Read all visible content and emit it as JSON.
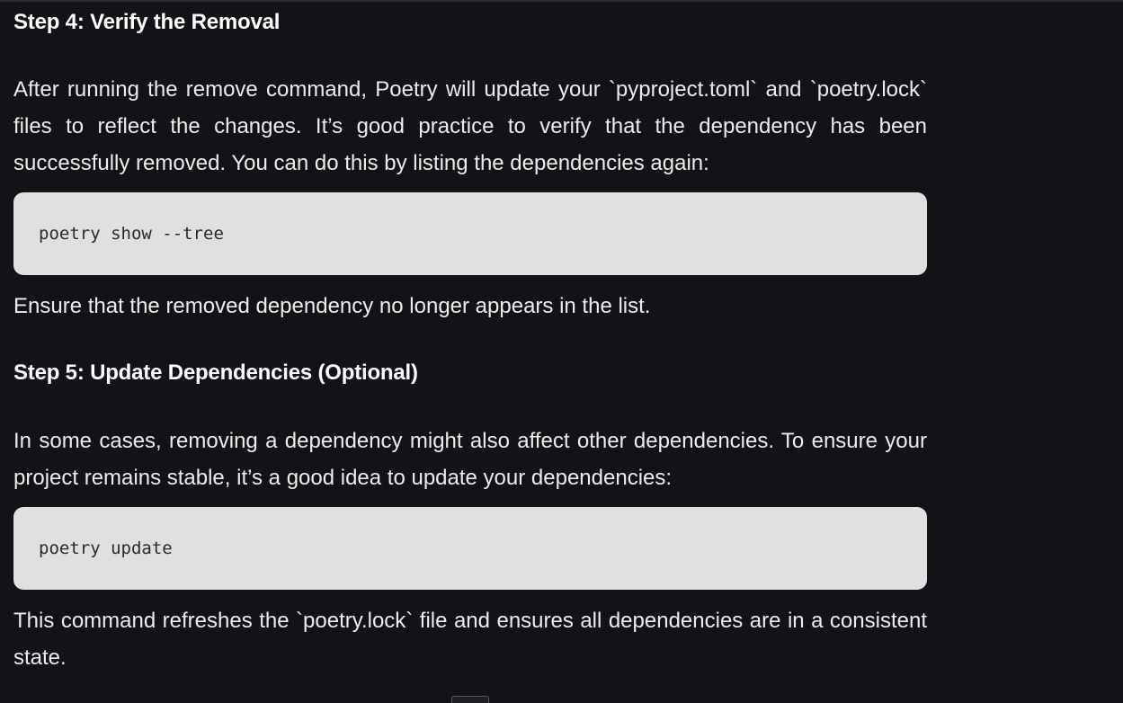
{
  "sections": [
    {
      "heading": "Step 4: Verify the Removal",
      "intro": "After running the remove command, Poetry will update your `pyproject.toml` and `poetry.lock` files to reflect the changes. It’s good practice to verify that the dependency has been successfully removed. You can do this by listing the dependencies again:",
      "code": "poetry show --tree",
      "outro": "Ensure that the removed dependency no longer appears in the list."
    },
    {
      "heading": "Step 5: Update Dependencies (Optional)",
      "intro": "In some cases, removing a dependency might also affect other dependencies. To ensure your project remains stable, it’s a good idea to update your dependencies:",
      "code": "poetry update",
      "outro": "This command refreshes the `poetry.lock` file and ensures all dependencies are in a consistent state."
    }
  ],
  "colors": {
    "background": "#121316",
    "text": "#ececec",
    "heading": "#ffffff",
    "code_background": "#e0e0e0",
    "code_text": "#2a2a2a"
  }
}
